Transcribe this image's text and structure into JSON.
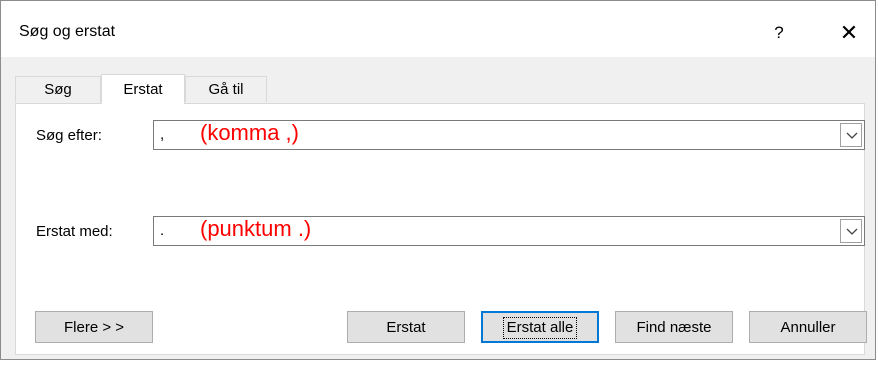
{
  "window": {
    "title": "Søg og erstat",
    "help_label": "?",
    "close_label": "✕"
  },
  "tabs": [
    {
      "label": "Søg",
      "active": false
    },
    {
      "label": "Erstat",
      "active": true
    },
    {
      "label": "Gå til",
      "active": false
    }
  ],
  "find": {
    "label": "Søg efter:",
    "value": ",",
    "annotation": "(komma ,)"
  },
  "replace": {
    "label": "Erstat med:",
    "value": ".",
    "annotation": "(punktum .)"
  },
  "buttons": {
    "more": "Flere > >",
    "replace": "Erstat",
    "replace_all": "Erstat alle",
    "find_next": "Find næste",
    "cancel": "Annuller"
  },
  "colors": {
    "annotation": "#ff0000",
    "default_button_border": "#0078d7"
  }
}
